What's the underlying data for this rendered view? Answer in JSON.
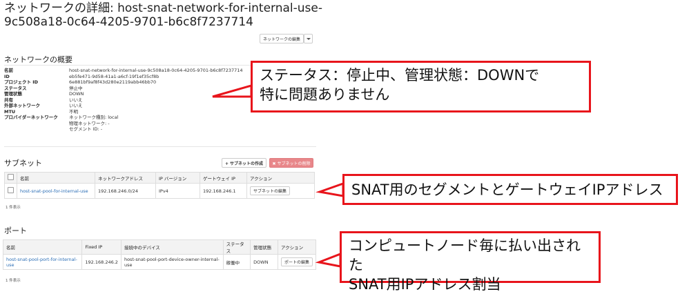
{
  "page": {
    "title": "ネットワークの詳細: host-snat-network-for-internal-use-9c508a18-0c64-4205-9701-b6c8f7237714",
    "edit_button": "ネットワークの編集"
  },
  "overview": {
    "heading": "ネットワークの概要",
    "rows": [
      {
        "label": "名前",
        "value": "host-snat-network-for-internal-use-9c508a18-0c64-4205-9701-b6c8f7237714"
      },
      {
        "label": "ID",
        "value": "eb5fe471-9d58-41a1-a6cf-19f1ef35cf8b"
      },
      {
        "label": "プロジェクト ID",
        "value": "6e881bf9af8f43d280e2119abb46bb70"
      },
      {
        "label": "ステータス",
        "value": "停止中"
      },
      {
        "label": "管理状態",
        "value": "DOWN"
      },
      {
        "label": "共有",
        "value": "いいえ"
      },
      {
        "label": "外部ネットワーク",
        "value": "いいえ"
      },
      {
        "label": "MTU",
        "value": "不明"
      },
      {
        "label": "プロバイダーネットワーク",
        "value": "ネットワーク種別: local"
      }
    ],
    "provider_extra": [
      "物理ネットワーク: -",
      "セグメント ID: -"
    ]
  },
  "subnets": {
    "heading": "サブネット",
    "create_button": "+ サブネットの作成",
    "delete_button": "✖ サブネットの削除",
    "columns": [
      "名前",
      "ネットワークアドレス",
      "IP バージョン",
      "ゲートウェイ IP",
      "アクション"
    ],
    "rows": [
      {
        "name": "host-snat-pool-for-internal-use",
        "cidr": "192.168.246.0/24",
        "ip_version": "IPv4",
        "gateway": "192.168.246.1",
        "action": "サブネットの編集"
      }
    ],
    "footer": "1 件表示"
  },
  "ports": {
    "heading": "ポート",
    "columns": [
      "名前",
      "Fixed IP",
      "接続中のデバイス",
      "ステータス",
      "管理状態",
      "アクション"
    ],
    "rows": [
      {
        "name": "host-snat-pool-port-for-internal-use",
        "fixed_ip": "192.168.246.2",
        "device": "host-snat-pool-port-device-owner-internal-use",
        "status": "稼働中",
        "admin_state": "DOWN",
        "action": "ポートの編集"
      }
    ],
    "footer": "1 件表示"
  },
  "callouts": {
    "status_note": [
      "ステータス：停止中、管理状態：DOWNで",
      "特に問題ありません"
    ],
    "subnet_note": [
      "SNAT用のセグメントとゲートウェイIPアドレス"
    ],
    "port_note": [
      "コンピュートノード毎に払い出された",
      "SNAT用IPアドレス割当"
    ]
  },
  "colors": {
    "callout_border": "#e8141b",
    "link": "#2a6db5",
    "danger_button": "#e8878a"
  }
}
